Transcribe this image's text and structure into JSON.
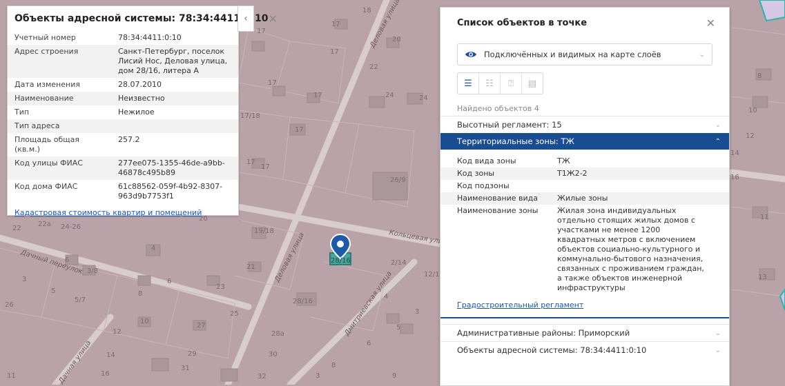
{
  "map": {
    "labels": [
      "18",
      "17",
      "17",
      "20",
      "17",
      "22",
      "8",
      "17",
      "17",
      "24",
      "24",
      "10",
      "17/18",
      "17",
      "12",
      "17",
      "17",
      "14",
      "26/9",
      "16",
      "20",
      "11",
      "22",
      "22a",
      "24-26",
      "19/18",
      "4",
      "6",
      "3",
      "3/8",
      "21",
      "6",
      "23",
      "5",
      "5/7",
      "8",
      "13",
      "28/16",
      "26",
      "25",
      "10",
      "12",
      "27",
      "28a",
      "14",
      "29",
      "30",
      "11",
      "16",
      "31",
      "32",
      "3",
      "8",
      "9",
      "2/14",
      "12/1",
      "4",
      "3",
      "5",
      "6",
      "28/16"
    ],
    "streets": [
      "Деловая улица",
      "Деловая улица",
      "Кольцевая улица",
      "Дачный переулок",
      "Дмитриевская улица",
      "Дачная улица"
    ]
  },
  "left_panel": {
    "title": "Объекты адресной системы: 78:34:4411:0:10",
    "rows": [
      {
        "key": "Учетный номер",
        "value": "78:34:4411:0:10"
      },
      {
        "key": "Адрес строения",
        "value": "Санкт-Петербург, поселок Лисий Нос, Деловая улица, дом 28/16, литера А"
      },
      {
        "key": "Дата изменения",
        "value": "28.07.2010"
      },
      {
        "key": "Наименование",
        "value": "Неизвестно"
      },
      {
        "key": "Тип",
        "value": "Нежилое"
      },
      {
        "key": "Тип адреса",
        "value": ""
      },
      {
        "key": "Площадь общая (кв.м.)",
        "value": "257.2"
      },
      {
        "key": "Код улицы ФИАС",
        "value": "277ee075-1355-46de-a9bb-46878c495b89"
      },
      {
        "key": "Код дома ФИАС",
        "value": "61c88562-059f-4b92-8307-963d9b7753f1"
      }
    ],
    "link": "Кадастровая стоимость квартир и помещений"
  },
  "right_panel": {
    "title": "Список объектов в точке",
    "dropdown": "Подключённых и видимых на карте слоёв",
    "found": "Найдено объектов 4",
    "sections": {
      "height": "Высотный регламент: 15",
      "zones": "Территориальные зоны: ТЖ",
      "districts": "Административные районы: Приморский",
      "address": "Объекты адресной системы: 78:34:4411:0:10"
    },
    "zone_rows": [
      {
        "key": "Код вида зоны",
        "value": "ТЖ"
      },
      {
        "key": "Код зоны",
        "value": "Т1Ж2-2"
      },
      {
        "key": "Код подзоны",
        "value": ""
      },
      {
        "key": "Наименование вида",
        "value": "Жилые зоны"
      },
      {
        "key": "Наименование зоны",
        "value": "Жилая зона индивидуальных отдельно стоящих жилых домов с участками не менее 1200 квадратных метров с включением объектов социально-культурного и коммунально-бытового назначения, связанных с проживанием граждан, а также объектов инженерной инфраструктуры"
      }
    ],
    "zone_link": "Градостроительный регламент"
  },
  "icons": {
    "close": "close-icon",
    "collapse": "chevron-left-icon",
    "layers": "eye-icon",
    "marker": "map-pin-icon"
  },
  "colors": {
    "map_bg": "#b9a3a8",
    "accent": "#1a4c92",
    "link": "#1a55b8",
    "selected_building": "#3aa6a0"
  }
}
